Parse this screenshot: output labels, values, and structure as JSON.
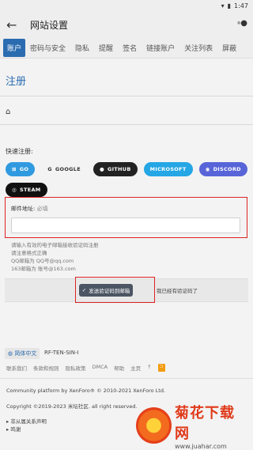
{
  "status": {
    "time": "1:47"
  },
  "appbar": {
    "title": "网站设置",
    "back_icon": "arrow-left-icon",
    "menu_icon": "more-icon"
  },
  "tabs": [
    "账户",
    "密码与安全",
    "隐私",
    "提醒",
    "签名",
    "链接账户",
    "关注列表",
    "屏蔽"
  ],
  "page": {
    "heading": "注册",
    "quick_label": "快速注册:",
    "sso": [
      "GO",
      "GOOGLE",
      "GITHUB",
      "MICROSOFT",
      "DISCORD",
      "STEAM"
    ],
    "email_label": "邮件地址:",
    "email_required": "必填",
    "email_value": "",
    "hints": [
      "请输入有效的电子邮箱接收验证码注册",
      "请注意格式正确",
      "QQ邮箱为 QQ号@qq.com",
      "163邮箱为 账号@163.com"
    ],
    "send_button": "发送验证码到邮箱",
    "have_code": "我已经有验证码了"
  },
  "footer": {
    "language": "简体中文",
    "style": "RF-TEN-SIN-I",
    "links": [
      "联系我们",
      "条款和规则",
      "隐私政策",
      "DMCA",
      "帮助",
      "主页"
    ],
    "platform": "Community platform by XenForo® © 2010-2021 XenForo Ltd.",
    "copyright": "Copyright ©2019-2023 米坛社区. all right reserved.",
    "disclaimer": "非从属关系声明",
    "thanks": "鸣谢"
  },
  "watermark": {
    "cn": "菊花下载网",
    "url": "www.juahar.com"
  }
}
